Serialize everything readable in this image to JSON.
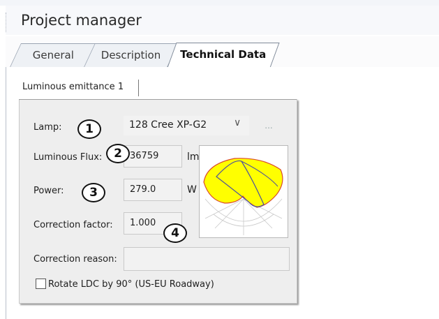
{
  "window": {
    "title": "Project manager"
  },
  "tabs": [
    {
      "label": "General"
    },
    {
      "label": "Description"
    },
    {
      "label": "Technical Data",
      "active": true
    }
  ],
  "subtab": {
    "label": "Luminous emittance 1"
  },
  "form": {
    "lamp_label": "Lamp:",
    "lamp_value": "128 Cree XP-G2",
    "more_button": "...",
    "flux_label": "Luminous Flux:",
    "flux_value": "36759",
    "flux_unit": "lm",
    "power_label": "Power:",
    "power_value": "279.0",
    "power_unit": "W",
    "correction_factor_label": "Correction factor:",
    "correction_factor_value": "1.000",
    "correction_reason_label": "Correction reason:",
    "correction_reason_value": "",
    "rotate_label": "Rotate LDC by 90° (US-EU Roadway)",
    "rotate_checked": false
  },
  "callouts": [
    "1",
    "2",
    "3",
    "4"
  ],
  "colors": {
    "ldc_fill": "#ffff00",
    "ldc_outline_red": "#d94a2a",
    "ldc_outline_blue": "#4a4fa0"
  },
  "icons": {
    "dropdown": "chevron-down-icon",
    "ldc": "light-distribution-curve-icon"
  }
}
